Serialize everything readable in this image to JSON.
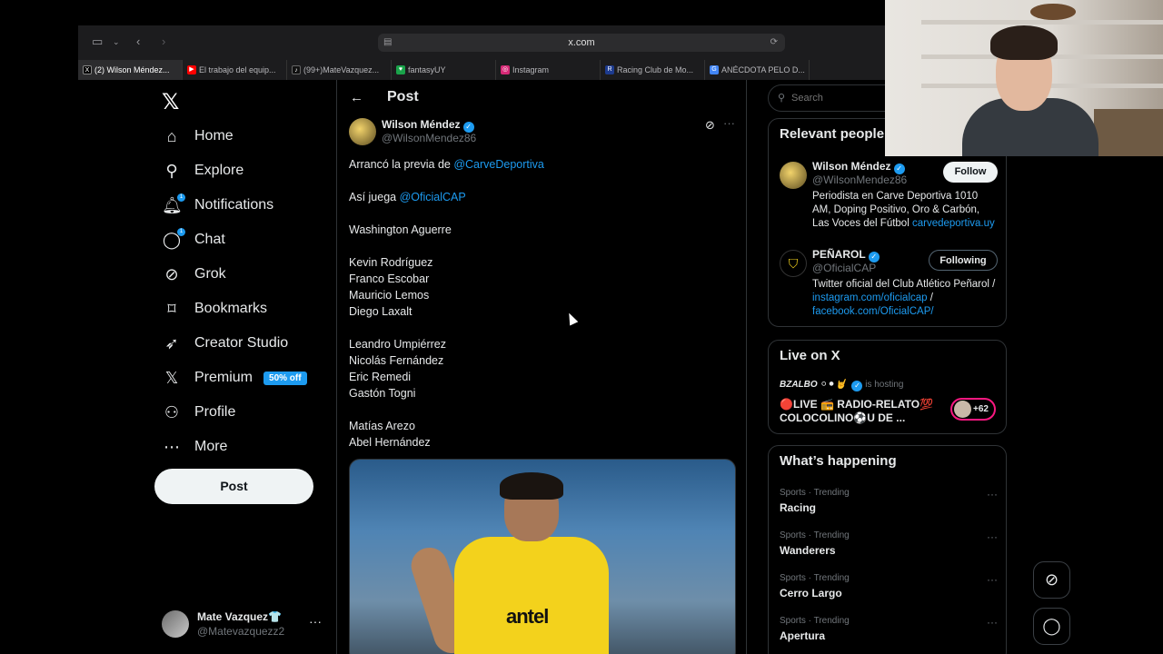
{
  "browser": {
    "url": "x.com",
    "tabs": [
      {
        "title": "(2) Wilson Méndez...",
        "icon": "x-favicon",
        "color": "#2c2c2e"
      },
      {
        "title": "El trabajo del equip...",
        "icon": "youtube-favicon",
        "color": "#ff0000"
      },
      {
        "title": "(99+)MateVazquez...",
        "icon": "tiktok-favicon",
        "color": "#111111"
      },
      {
        "title": "fantasyUY",
        "icon": "fantasy-favicon",
        "color": "#1aa34a"
      },
      {
        "title": "Instagram",
        "icon": "instagram-favicon",
        "color": "#d62976"
      },
      {
        "title": "Racing Club de Mo...",
        "icon": "racing-favicon",
        "color": "#1d3b8f"
      },
      {
        "title": "ANÉCDOTA PELO D...",
        "icon": "google-favicon",
        "color": "#4285f4"
      }
    ]
  },
  "nav": {
    "items": [
      {
        "label": "Home",
        "icon": "home-icon"
      },
      {
        "label": "Explore",
        "icon": "search-icon"
      },
      {
        "label": "Notifications",
        "icon": "bell-icon",
        "badge": "1"
      },
      {
        "label": "Chat",
        "icon": "chat-icon",
        "badge": "1"
      },
      {
        "label": "Grok",
        "icon": "grok-icon"
      },
      {
        "label": "Bookmarks",
        "icon": "bookmark-icon"
      },
      {
        "label": "Creator Studio",
        "icon": "rocket-icon"
      },
      {
        "label": "Premium",
        "icon": "x-logo-icon",
        "tag": "50% off"
      },
      {
        "label": "Profile",
        "icon": "person-icon"
      },
      {
        "label": "More",
        "icon": "more-circle-icon"
      }
    ],
    "post_button": "Post",
    "account": {
      "name": "Mate Vazquez👕",
      "handle": "@Matevazquezz2"
    }
  },
  "post": {
    "header_title": "Post",
    "author_name": "Wilson Méndez",
    "author_handle": "@WilsonMendez86",
    "lines": [
      {
        "text": "Arrancó la previa de ",
        "link": "@CarveDeportiva"
      },
      {
        "text": ""
      },
      {
        "text": "Así juega ",
        "link": "@OficialCAP"
      },
      {
        "text": ""
      },
      {
        "text": "Washington Aguerre"
      },
      {
        "text": ""
      },
      {
        "text": "Kevin Rodríguez"
      },
      {
        "text": "Franco Escobar"
      },
      {
        "text": "Mauricio Lemos"
      },
      {
        "text": "Diego Laxalt"
      },
      {
        "text": ""
      },
      {
        "text": "Leandro Umpiérrez"
      },
      {
        "text": "Nicolás Fernández"
      },
      {
        "text": "Eric Remedi"
      },
      {
        "text": "Gastón Togni"
      },
      {
        "text": ""
      },
      {
        "text": "Matías Arezo"
      },
      {
        "text": "Abel Hernández"
      }
    ],
    "media_text": "antel"
  },
  "sidebar": {
    "search_placeholder": "Search",
    "relevant": {
      "title": "Relevant people",
      "people": [
        {
          "name": "Wilson Méndez",
          "handle": "@WilsonMendez86",
          "bio": "Periodista en Carve Deportiva 1010 AM, Doping Positivo, Oro & Carbón, Las Voces del Fútbol ",
          "bio_link": "carvedeportiva.uy",
          "button": "Follow"
        },
        {
          "name": "PEÑAROL",
          "handle": "@OficialCAP",
          "bio": "Twitter oficial del Club Atlético Peñarol / ",
          "bio_link": "instagram.com/oficialcap",
          "bio_mid": " / ",
          "bio_link2": "facebook.com/OficialCAP/",
          "button": "Following"
        }
      ]
    },
    "live": {
      "title": "Live on X",
      "host": "BZALBO ⚪⚫🤘",
      "hosting": "is hosting",
      "space_title": "🔴LIVE 📻 RADIO-RELATO💯 COLOCOLINO⚽U DE ...",
      "listeners": "+62"
    },
    "happening": {
      "title": "What’s happening",
      "trends": [
        {
          "meta": "Sports · Trending",
          "name": "Racing"
        },
        {
          "meta": "Sports · Trending",
          "name": "Wanderers"
        },
        {
          "meta": "Sports · Trending",
          "name": "Cerro Largo"
        },
        {
          "meta": "Sports · Trending",
          "name": "Apertura"
        }
      ]
    }
  },
  "colors": {
    "accent": "#1d9bf0",
    "background": "#000000",
    "border": "#2f3336",
    "live": "#f91880"
  }
}
